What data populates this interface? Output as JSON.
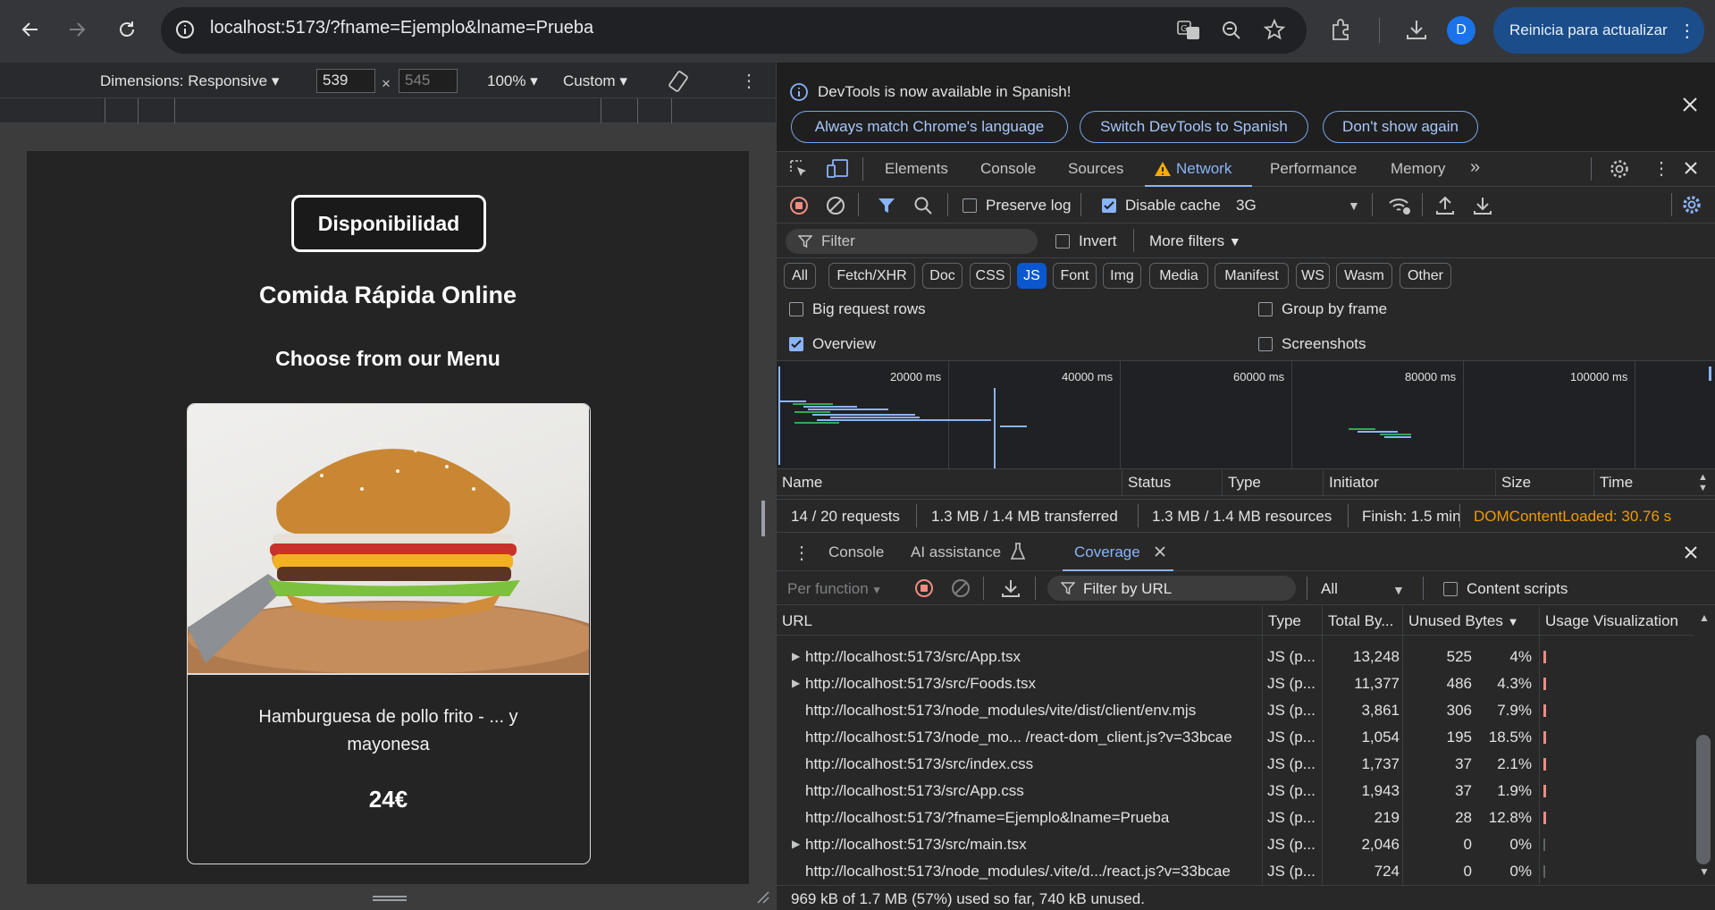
{
  "browser": {
    "url": "localhost:5173/?fname=Ejemplo&lname=Prueba",
    "update_button": "Reinicia para actualizar",
    "avatar_letter": "D"
  },
  "device_toolbar": {
    "dimensions_label": "Dimensions: Responsive",
    "width": "539",
    "height": "545",
    "zoom": "100%",
    "throttle": "Custom"
  },
  "app": {
    "availability_button": "Disponibilidad",
    "title": "Comida Rápida Online",
    "menu_heading": "Choose from our Menu",
    "food_name": "Hamburguesa de pollo frito - ... y mayonesa",
    "food_price": "24€"
  },
  "infobar": {
    "message": "DevTools is now available in Spanish!",
    "buttons": [
      "Always match Chrome's language",
      "Switch DevTools to Spanish",
      "Don't show again"
    ]
  },
  "tabs": [
    "Elements",
    "Console",
    "Sources",
    "Network",
    "Performance",
    "Memory"
  ],
  "network": {
    "preserve_log": "Preserve log",
    "disable_cache": "Disable cache",
    "throttle": "3G",
    "filter_placeholder": "Filter",
    "invert": "Invert",
    "more_filters": "More filters",
    "type_filters": [
      "All",
      "Fetch/XHR",
      "Doc",
      "CSS",
      "JS",
      "Font",
      "Img",
      "Media",
      "Manifest",
      "WS",
      "Wasm",
      "Other"
    ],
    "big_request_rows": "Big request rows",
    "group_by_frame": "Group by frame",
    "overview": "Overview",
    "screenshots": "Screenshots",
    "timeline_labels": [
      "20000 ms",
      "40000 ms",
      "60000 ms",
      "80000 ms",
      "100000 ms"
    ],
    "columns": [
      "Name",
      "Status",
      "Type",
      "Initiator",
      "Size",
      "Time"
    ],
    "summary": [
      "14 / 20 requests",
      "1.3 MB / 1.4 MB transferred",
      "1.3 MB / 1.4 MB resources",
      "Finish: 1.5 min",
      "DOMContentLoaded: 30.76 s"
    ]
  },
  "drawer": {
    "tabs": [
      "Console",
      "AI assistance",
      "Coverage"
    ],
    "per_function": "Per function",
    "filter_url": "Filter by URL",
    "type_select": "All",
    "content_scripts": "Content scripts",
    "columns": [
      "URL",
      "Type",
      "Total By...",
      "Unused Bytes",
      "Usage Visualization"
    ],
    "rows": [
      {
        "url": "http://localhost:5173/src/App.tsx",
        "type": "JS (p...",
        "total": "13,248",
        "unused": "525",
        "pct": "4%",
        "expandable": true,
        "usage": 0.04
      },
      {
        "url": "http://localhost:5173/src/Foods.tsx",
        "type": "JS (p...",
        "total": "11,377",
        "unused": "486",
        "pct": "4.3%",
        "expandable": true,
        "usage": 0.043
      },
      {
        "url": "http://localhost:5173/node_modules/vite/dist/client/env.mjs",
        "type": "JS (p...",
        "total": "3,861",
        "unused": "306",
        "pct": "7.9%",
        "expandable": false,
        "usage": 0.079
      },
      {
        "url": "http://localhost:5173/node_mo... /react-dom_client.js?v=33bcae",
        "type": "JS (p...",
        "total": "1,054",
        "unused": "195",
        "pct": "18.5%",
        "expandable": false,
        "usage": 0.185
      },
      {
        "url": "http://localhost:5173/src/index.css",
        "type": "JS (p...",
        "total": "1,737",
        "unused": "37",
        "pct": "2.1%",
        "expandable": false,
        "usage": 0.021
      },
      {
        "url": "http://localhost:5173/src/App.css",
        "type": "JS (p...",
        "total": "1,943",
        "unused": "37",
        "pct": "1.9%",
        "expandable": false,
        "usage": 0.019
      },
      {
        "url": "http://localhost:5173/?fname=Ejemplo&lname=Prueba",
        "type": "JS (p...",
        "total": "219",
        "unused": "28",
        "pct": "12.8%",
        "expandable": false,
        "usage": 0.128
      },
      {
        "url": "http://localhost:5173/src/main.tsx",
        "type": "JS (p...",
        "total": "2,046",
        "unused": "0",
        "pct": "0%",
        "expandable": true,
        "usage": 0
      },
      {
        "url": "http://localhost:5173/node_modules/.vite/d.../react.js?v=33bcae",
        "type": "JS (p...",
        "total": "724",
        "unused": "0",
        "pct": "0%",
        "expandable": false,
        "usage": 0
      }
    ],
    "footer": "969 kB of 1.7 MB (57%) used so far, 740 kB unused."
  },
  "colors": {
    "accent": "#8ab4f8",
    "warning": "#f28b82",
    "dom_content_loaded": "#f29900",
    "active_chip": "#0b57d0"
  }
}
